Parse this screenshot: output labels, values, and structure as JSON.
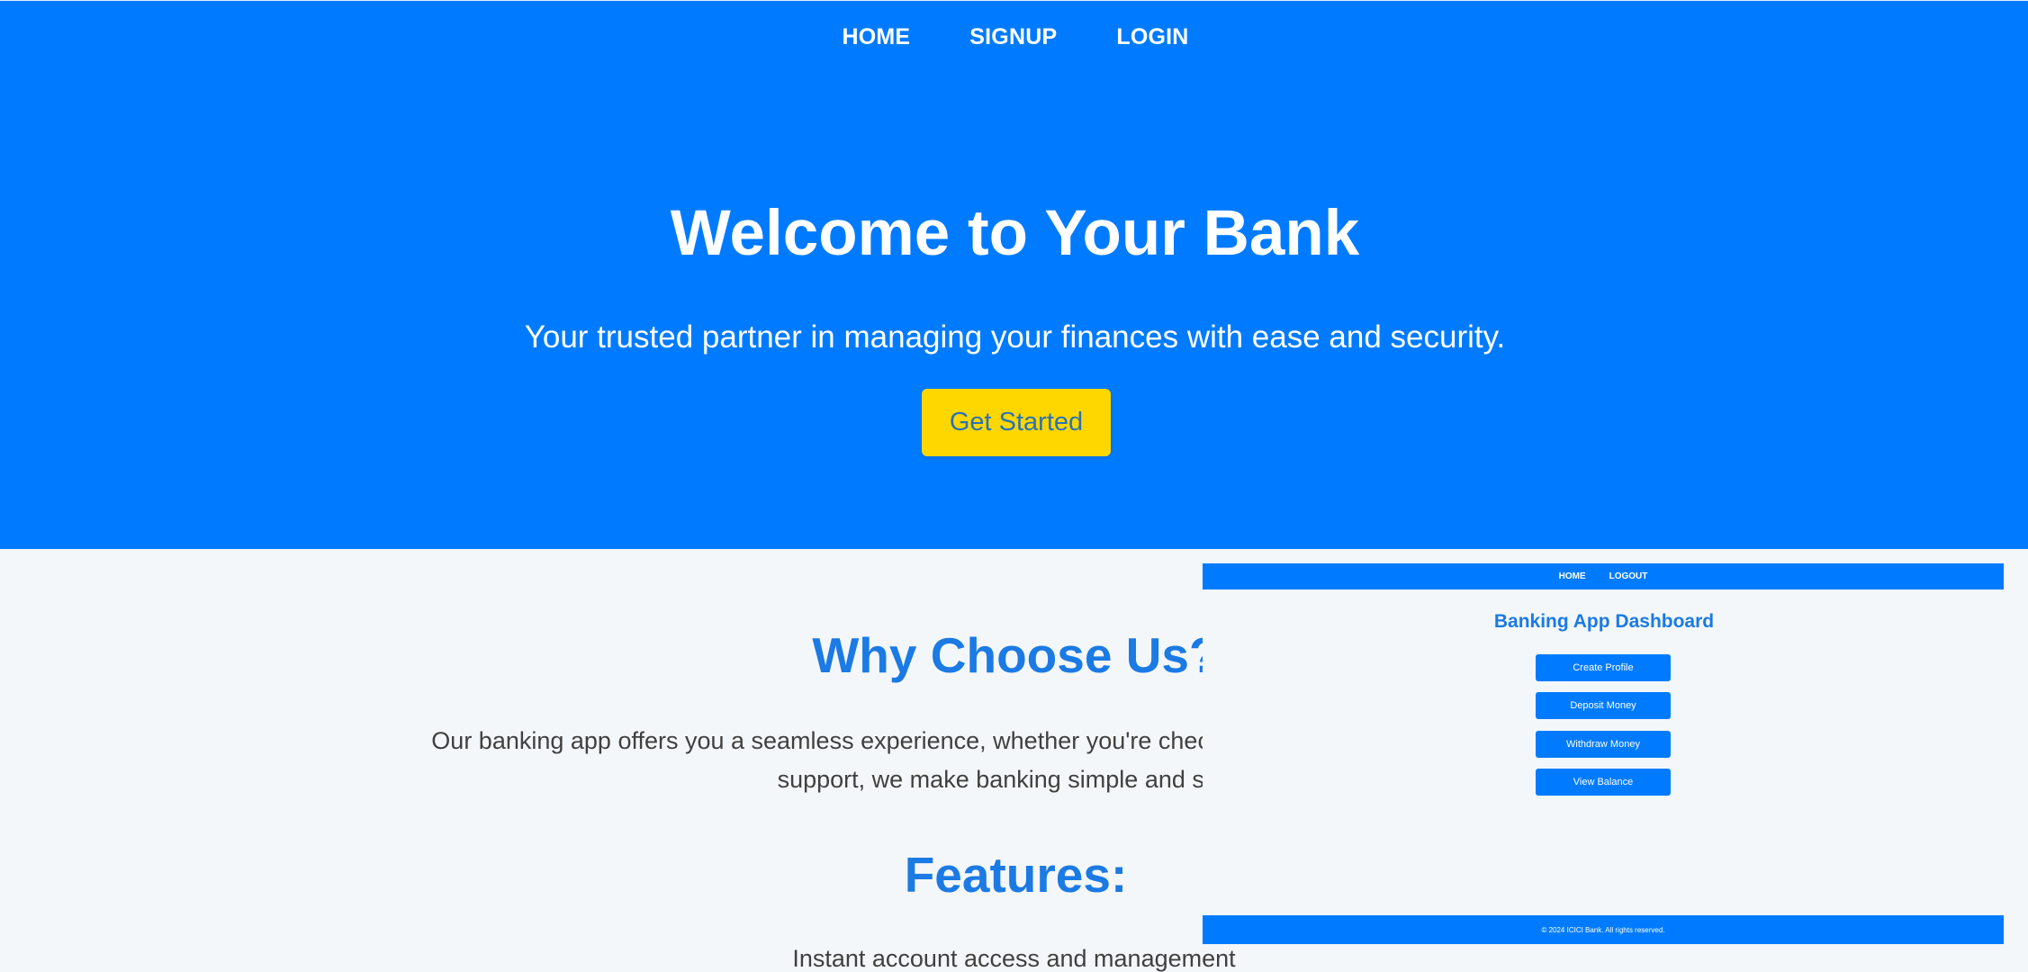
{
  "nav": {
    "items": [
      "HOME",
      "SIGNUP",
      "LOGIN"
    ]
  },
  "hero": {
    "title": "Welcome to Your Bank",
    "subtitle": "Your trusted partner in managing your finances with ease and security.",
    "cta_label": "Get Started"
  },
  "why": {
    "title": "Why Choose Us?",
    "line1": "Our banking app offers you a seamless experience, whether you're checking your balance, transferring funds",
    "line2": "support, we make banking simple and stress"
  },
  "features": {
    "title": "Features:",
    "items": [
      "Instant account access and management"
    ]
  },
  "dashboard": {
    "nav_items": [
      "HOME",
      "LOGOUT"
    ],
    "title": "Banking App Dashboard",
    "buttons": [
      "Create Profile",
      "Deposit Money",
      "Withdraw Money",
      "View Balance"
    ],
    "footer": "© 2024 ICICI Bank. All rights reserved."
  },
  "colors": {
    "primary": "#007bff",
    "accent": "#ffd700",
    "heading": "#1b7ae4",
    "background": "#f4f7f9",
    "body_text": "#404040"
  }
}
